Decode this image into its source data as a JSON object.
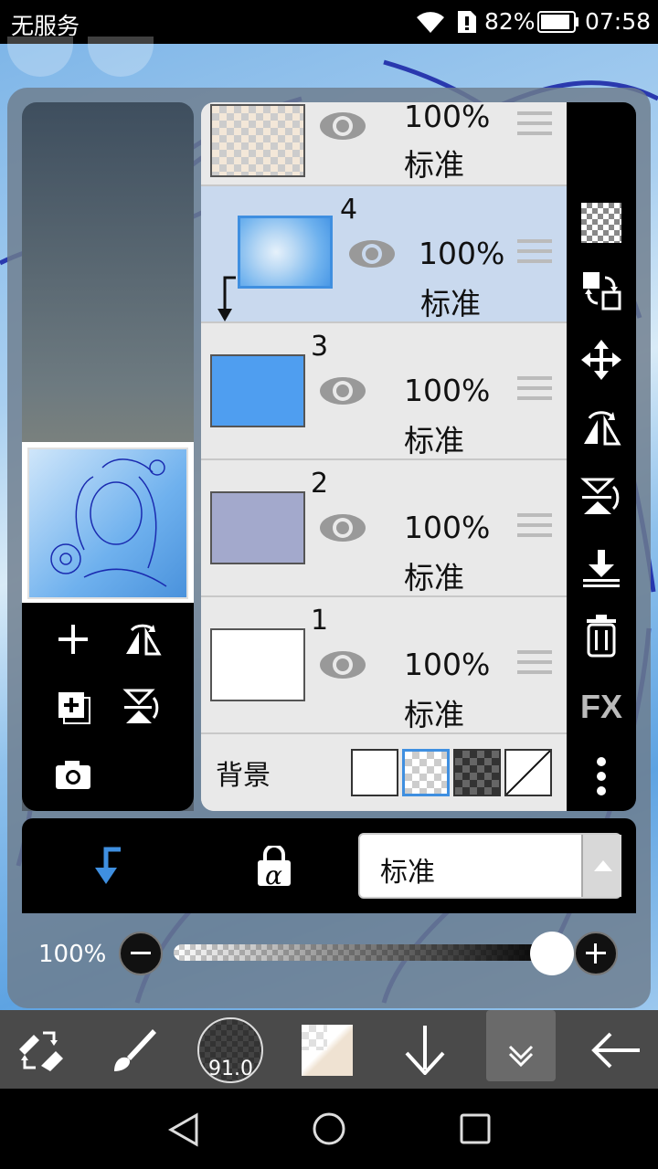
{
  "status_bar": {
    "carrier": "无服务",
    "battery": "82%",
    "time": "07:58"
  },
  "layers": [
    {
      "number": "",
      "opacity": "100%",
      "mode": "标准",
      "thumb": "checker-beige"
    },
    {
      "number": "4",
      "opacity": "100%",
      "mode": "标准",
      "thumb": "sky",
      "selected": true,
      "clipped": true
    },
    {
      "number": "3",
      "opacity": "100%",
      "mode": "标准",
      "thumb": "#4f9ef0"
    },
    {
      "number": "2",
      "opacity": "100%",
      "mode": "标准",
      "thumb": "#a3a9cc"
    },
    {
      "number": "1",
      "opacity": "100%",
      "mode": "标准",
      "thumb": "#ffffff"
    }
  ],
  "background_row": {
    "label": "背景",
    "options": [
      "white",
      "checker",
      "dark-checker",
      "none"
    ],
    "selected": "checker"
  },
  "side_toolbar": {
    "icons": [
      "transparency-checker-icon",
      "swap-layers-icon",
      "move-icon",
      "flip-horizontal-icon",
      "flip-vertical-icon",
      "merge-down-icon",
      "trash-icon",
      "fx-icon",
      "more-vertical-icon"
    ],
    "fx_label": "FX"
  },
  "left_tools": {
    "icons": [
      "add-layer-icon",
      "flip-horizontal-icon",
      "copy-layer-icon",
      "flip-vertical-icon",
      "camera-icon"
    ]
  },
  "blend": {
    "mode_value": "标准",
    "alpha_lock_label": "α"
  },
  "opacity": {
    "label": "100%",
    "value": 1.0
  },
  "bottom_toolbar": {
    "brush_size": "91.0"
  },
  "colors": {
    "accent": "#3f8fe0",
    "selected_row": "#c9d9ee"
  }
}
